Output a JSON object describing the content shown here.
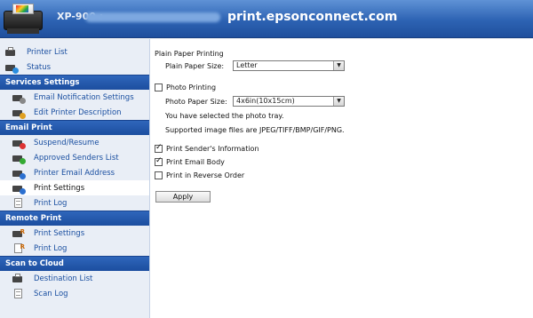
{
  "header": {
    "model": "XP-900 :",
    "domain": "print.epsonconnect.com"
  },
  "sidebar": {
    "top_items": [
      {
        "label": "Printer List",
        "icon": "printer-list-icon"
      },
      {
        "label": "Status",
        "icon": "status-icon"
      }
    ],
    "sections": [
      {
        "title": "Services Settings",
        "items": [
          {
            "label": "Email Notification Settings",
            "icon": "email-notification-icon"
          },
          {
            "label": "Edit Printer Description",
            "icon": "edit-description-icon"
          }
        ]
      },
      {
        "title": "Email Print",
        "items": [
          {
            "label": "Suspend/Resume",
            "icon": "suspend-resume-icon"
          },
          {
            "label": "Approved Senders List",
            "icon": "approved-senders-icon"
          },
          {
            "label": "Printer Email Address",
            "icon": "email-address-icon"
          },
          {
            "label": "Print Settings",
            "icon": "print-settings-icon",
            "active": true
          },
          {
            "label": "Print Log",
            "icon": "print-log-icon"
          }
        ]
      },
      {
        "title": "Remote Print",
        "items": [
          {
            "label": "Print Settings",
            "icon": "remote-print-settings-icon"
          },
          {
            "label": "Print Log",
            "icon": "remote-print-log-icon"
          }
        ]
      },
      {
        "title": "Scan to Cloud",
        "items": [
          {
            "label": "Destination List",
            "icon": "destination-list-icon"
          },
          {
            "label": "Scan Log",
            "icon": "scan-log-icon"
          }
        ]
      }
    ]
  },
  "settings": {
    "plain_heading": "Plain Paper Printing",
    "plain_size_label": "Plain Paper Size:",
    "plain_size_value": "Letter",
    "photo_label": "Photo Printing",
    "photo_checked": false,
    "photo_size_label": "Photo Paper Size:",
    "photo_size_value": "4x6in(10x15cm)",
    "photo_note": "You have selected the photo tray.",
    "photo_formats": "Supported image files are JPEG/TIFF/BMP/GIF/PNG.",
    "sender_info_label": "Print Sender's Information",
    "sender_info_checked": true,
    "email_body_label": "Print Email Body",
    "email_body_checked": true,
    "reverse_order_label": "Print in Reverse Order",
    "reverse_order_checked": false,
    "apply_label": "Apply"
  },
  "colors": {
    "header_blue": "#2d63b3",
    "section_blue": "#1c4e9f",
    "link_blue": "#1a4fa0"
  }
}
